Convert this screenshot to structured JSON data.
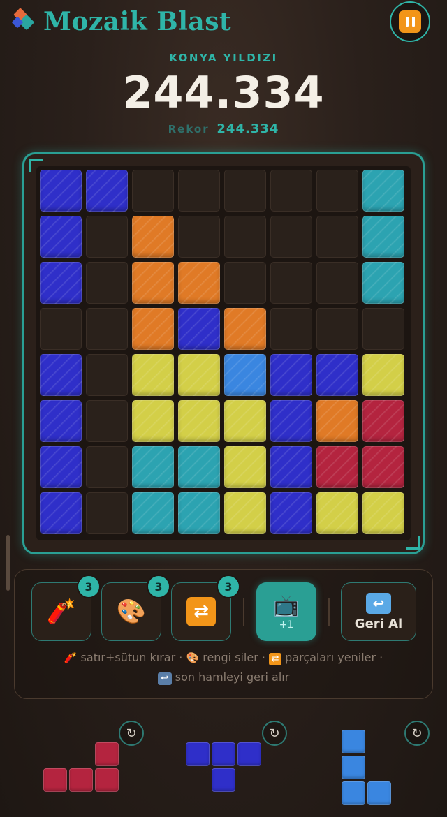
{
  "header": {
    "title": "Mozaik Blast",
    "level_label": "KONYA YILDIZI",
    "score": "244.334",
    "record_label": "Rekor",
    "record_value": "244.334"
  },
  "colors": {
    "B": "#2f2fc9",
    "O": "#e07a26",
    "T": "#2ca3b1",
    "Y": "#d3cf48",
    "L": "#3a86e0",
    "R": "#b4243f",
    "accent": "#2fb5a8",
    "orange_ui": "#f29519"
  },
  "board": [
    [
      "B",
      "B",
      ".",
      ".",
      ".",
      ".",
      ".",
      "T"
    ],
    [
      "B",
      ".",
      "O",
      ".",
      ".",
      ".",
      ".",
      "T"
    ],
    [
      "B",
      ".",
      "O",
      "O",
      ".",
      ".",
      ".",
      "T"
    ],
    [
      ".",
      ".",
      "O",
      "B",
      "O",
      ".",
      ".",
      "."
    ],
    [
      "B",
      ".",
      "Y",
      "Y",
      "L",
      "B",
      "B",
      "Y"
    ],
    [
      "B",
      ".",
      "Y",
      "Y",
      "Y",
      "B",
      "O",
      "R"
    ],
    [
      "B",
      ".",
      "T",
      "T",
      "Y",
      "B",
      "R",
      "R"
    ],
    [
      "B",
      ".",
      "T",
      "T",
      "Y",
      "B",
      "Y",
      "Y"
    ]
  ],
  "tools": {
    "bomb": {
      "icon": "firecracker-icon",
      "count": "3"
    },
    "paint": {
      "icon": "palette-icon",
      "count": "3"
    },
    "shuffle": {
      "icon": "shuffle-icon",
      "count": "3"
    },
    "ad": {
      "icon": "tv-icon",
      "label": "+1"
    },
    "undo": {
      "icon": "undo-icon",
      "label": "Geri Al"
    }
  },
  "help": {
    "line1_a": "satır+sütun kırar ·",
    "line1_b": "rengi siler ·",
    "line1_c": "parçaları yeniler ·",
    "line2": "son hamleyi geri alır"
  },
  "pieces": [
    {
      "color": "R",
      "cells": [
        [
          0,
          2
        ],
        [
          1,
          0
        ],
        [
          1,
          1
        ],
        [
          1,
          2
        ]
      ]
    },
    {
      "color": "B",
      "cells": [
        [
          0,
          0
        ],
        [
          0,
          1
        ],
        [
          0,
          2
        ],
        [
          1,
          1
        ]
      ]
    },
    {
      "color": "L",
      "cells": [
        [
          0,
          0
        ],
        [
          1,
          0
        ],
        [
          2,
          0
        ],
        [
          2,
          1
        ]
      ]
    }
  ]
}
